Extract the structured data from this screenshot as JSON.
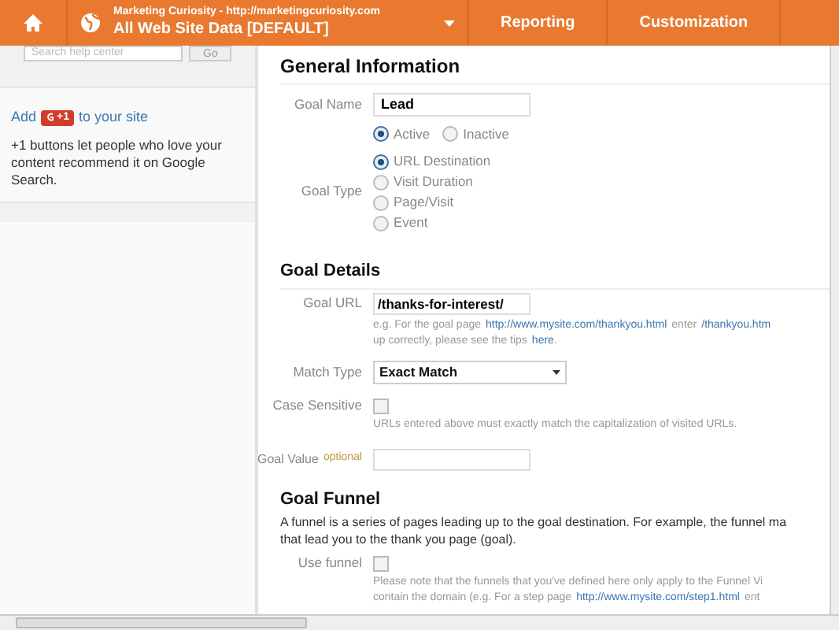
{
  "header": {
    "site_name": "Marketing Curiosity - http://marketingcuriosity.com",
    "profile": "All Web Site Data [DEFAULT]",
    "nav": [
      {
        "label": "Reporting",
        "selected": false
      },
      {
        "label": "Customization",
        "selected": false
      }
    ]
  },
  "sidebar": {
    "search": {
      "placeholder": "Search help center",
      "button": "Go"
    },
    "add_prefix": "Add",
    "plus_badge": "+1",
    "add_suffix": "to your site",
    "description": "+1 buttons let people who love your content recommend it on Google Search."
  },
  "general": {
    "title": "General Information",
    "goal_name_label": "Goal Name",
    "goal_name": "Lead",
    "status": [
      {
        "label": "Active",
        "selected": true
      },
      {
        "label": "Inactive",
        "selected": false
      }
    ],
    "goal_type_label": "Goal Type",
    "goal_types": [
      {
        "label": "URL Destination",
        "selected": true
      },
      {
        "label": "Visit Duration",
        "selected": false
      },
      {
        "label": "Page/Visit",
        "selected": false
      },
      {
        "label": "Event",
        "selected": false
      }
    ]
  },
  "details": {
    "title": "Goal Details",
    "goal_url_label": "Goal URL",
    "goal_url": "/thanks-for-interest/",
    "help_1a": "e.g. For the goal page",
    "help_link": "http://www.mysite.com/thankyou.html",
    "help_1b": "enter",
    "help_1c": "/thankyou.htm",
    "help_2a": "up correctly, please see the tips",
    "help_2_link": "here",
    "help_2b": ".",
    "match_type_label": "Match Type",
    "match_type": "Exact Match",
    "case_label": "Case Sensitive",
    "case_checked": false,
    "case_note": "URLs entered above must exactly match the capitalization of visited URLs.",
    "value_label": "Goal Value",
    "value_optional": "optional"
  },
  "funnel": {
    "title": "Goal Funnel",
    "para_1": "A funnel is a series of pages leading up to the goal destination. For example, the funnel ma",
    "para_2": "that lead you to the thank you page (goal).",
    "use_label": "Use funnel",
    "use_checked": false,
    "note_1": "Please note that the funnels that you've defined here only apply to the Funnel Vi",
    "note_2a": "contain the domain (e.g. For a step page",
    "note_2_link": "http://www.mysite.com/step1.html",
    "note_2b": "ent"
  }
}
